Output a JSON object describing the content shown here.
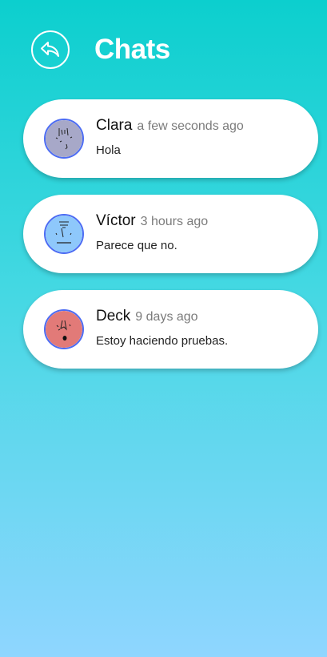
{
  "header": {
    "title": "Chats",
    "back_icon": "reply-arrow-icon"
  },
  "colors": {
    "gradient_top": "#0ccfce",
    "gradient_bottom": "#8fd6ff",
    "avatar_border": "#4c6cf3",
    "card_background": "#ffffff",
    "time_text": "#7b7b7b"
  },
  "chats": [
    {
      "name": "Clara",
      "time": "a few seconds ago",
      "message": "Hola",
      "avatar_color": "#a7a8c8",
      "avatar_icon": "face-sketch-icon"
    },
    {
      "name": "Víctor",
      "time": "3 hours ago",
      "message": "Parece que no.",
      "avatar_color": "#8ec8fb",
      "avatar_icon": "face-sketch-icon"
    },
    {
      "name": "Deck",
      "time": "9 days ago",
      "message": "Estoy haciendo pruebas.",
      "avatar_color": "#e27a78",
      "avatar_icon": "face-sketch-icon"
    }
  ]
}
